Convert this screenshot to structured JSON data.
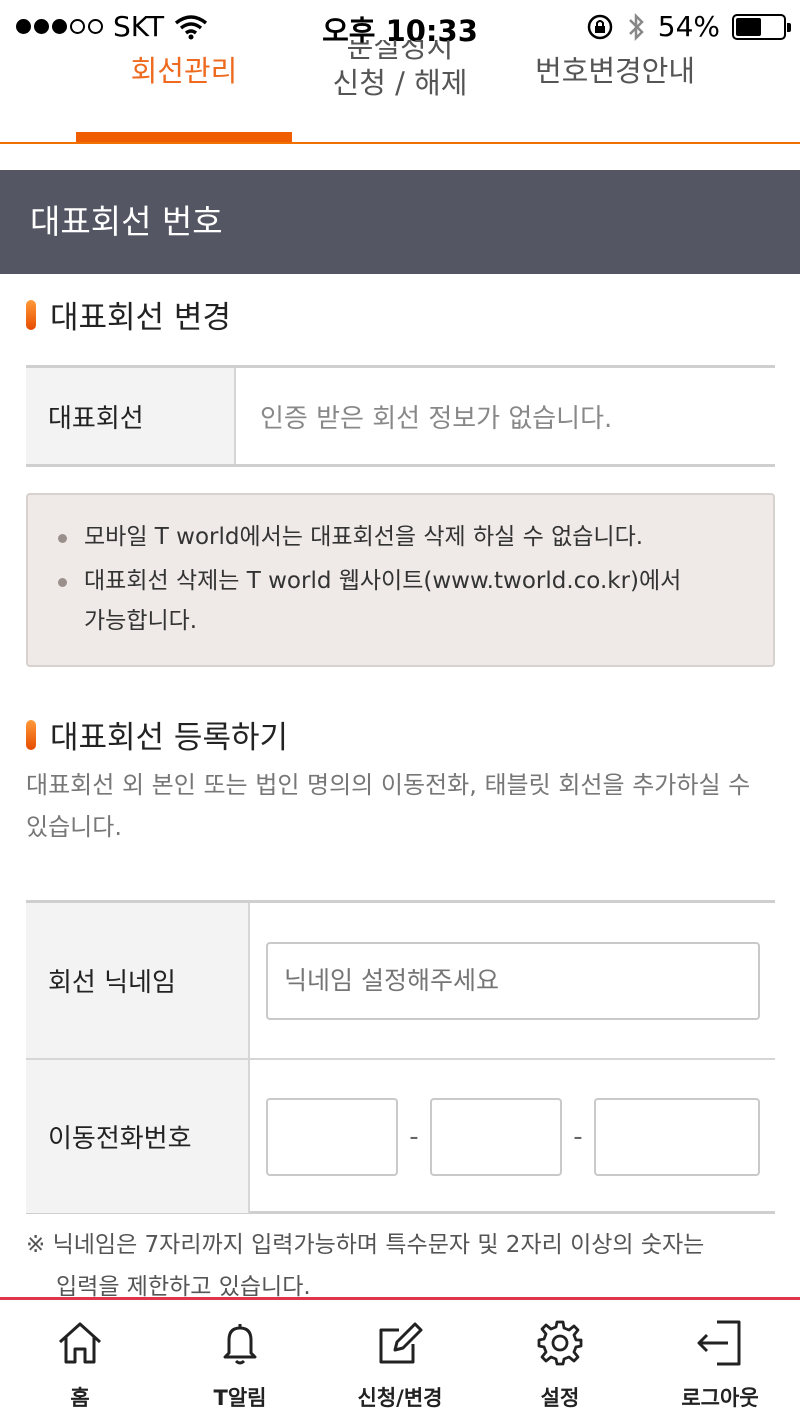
{
  "status_bar": {
    "carrier": "SKT",
    "time": "오후 10:33",
    "battery_percent": "54%",
    "battery_level": 0.54
  },
  "tabs": [
    {
      "label": "회선관리",
      "active": true
    },
    {
      "label_top": "분실정지",
      "label": "신청 / 해제",
      "active": false
    },
    {
      "label": "번호변경안내",
      "active": false
    }
  ],
  "section_header": {
    "title": "대표회선 번호"
  },
  "change_section": {
    "title": "대표회선 변경",
    "row_label": "대표회선",
    "row_value": "인증 받은 회선 정보가 없습니다."
  },
  "notice": {
    "items": [
      "모바일 T world에서는 대표회선을 삭제 하실 수 없습니다.",
      "대표회선 삭제는 T world 웹사이트(www.tworld.co.kr)에서 가능합니다."
    ]
  },
  "register_section": {
    "title": "대표회선 등록하기",
    "description": "대표회선 외 본인 또는 법인 명의의 이동전화, 태블릿 회선을 추가하실 수 있습니다.",
    "nickname_label": "회선 닉네임",
    "nickname_placeholder": "닉네임 설정해주세요",
    "phone_label": "이동전화번호",
    "phone_separator": "-"
  },
  "footnote": {
    "line1": "※ 닉네임은 7자리까지 입력가능하며 특수문자 및 2자리 이상의 숫자는",
    "line2": "입력을 제한하고 있습니다."
  },
  "bottom_nav": [
    {
      "label": "홈",
      "icon": "home-icon"
    },
    {
      "label": "T알림",
      "icon": "bell-icon"
    },
    {
      "label": "신청/변경",
      "icon": "edit-icon"
    },
    {
      "label": "설정",
      "icon": "gear-icon"
    },
    {
      "label": "로그아웃",
      "icon": "logout-icon"
    }
  ],
  "colors": {
    "accent": "#ee6a1f",
    "header_bg": "#545663",
    "nav_border": "#e0334e",
    "notice_bg": "#efeae8"
  }
}
